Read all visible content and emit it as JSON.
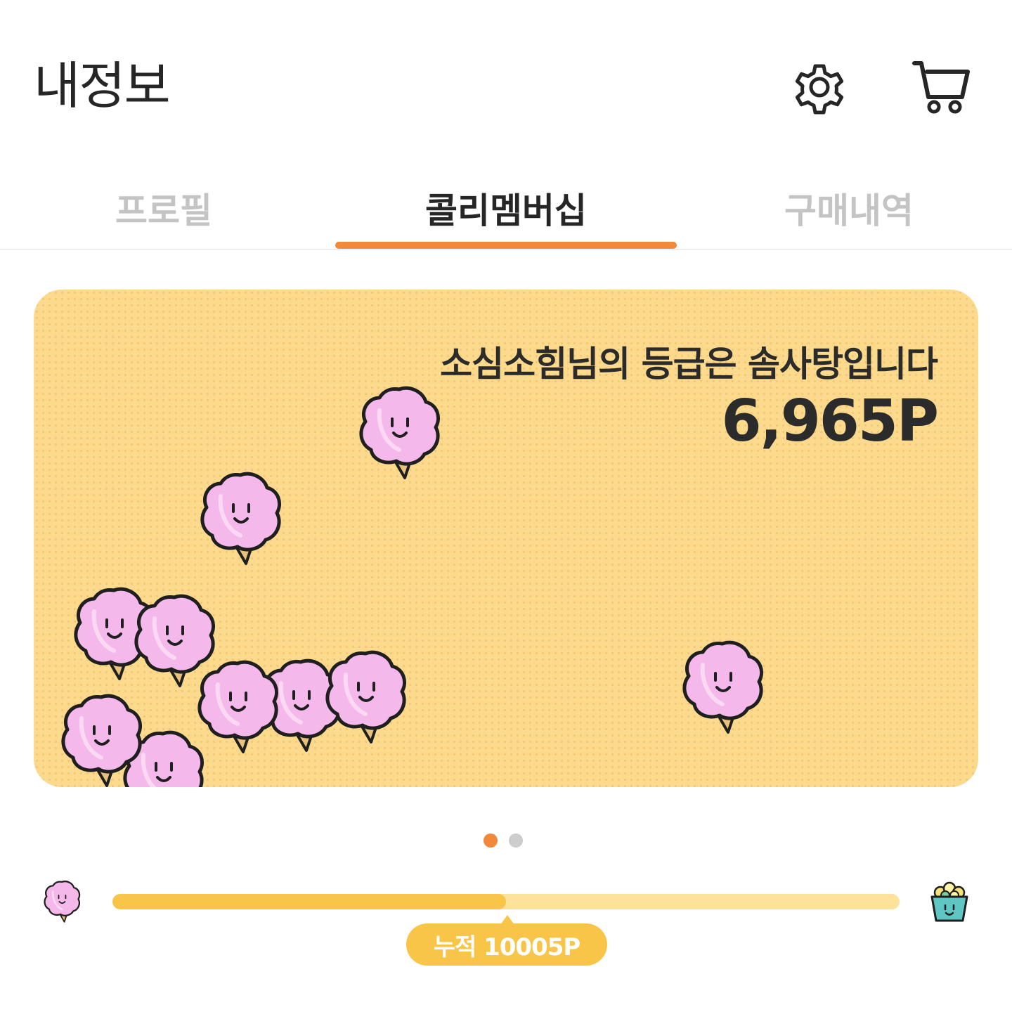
{
  "header": {
    "title": "내정보",
    "icons": [
      "settings-icon",
      "cart-icon"
    ]
  },
  "tabs": [
    {
      "label": "프로필",
      "active": false
    },
    {
      "label": "콜리멤버십",
      "active": true
    },
    {
      "label": "구매내역",
      "active": false
    }
  ],
  "card": {
    "grade_message": "소심소힘님의 등급은 솜사탕입니다",
    "points": "6,965P",
    "decoration_icon": "cotton-candy-icon"
  },
  "carousel": {
    "pages": 2,
    "active_index": 0
  },
  "progress": {
    "start_icon": "cotton-candy-icon",
    "end_icon": "popcorn-icon",
    "fraction": 0.5,
    "label": "누적 10005P"
  },
  "colors": {
    "accent": "#f2883a",
    "card_bg": "#fcda8d",
    "progress_fill": "#f8c549",
    "progress_track": "#fde29b",
    "candy_pink": "#f5b8ea"
  }
}
